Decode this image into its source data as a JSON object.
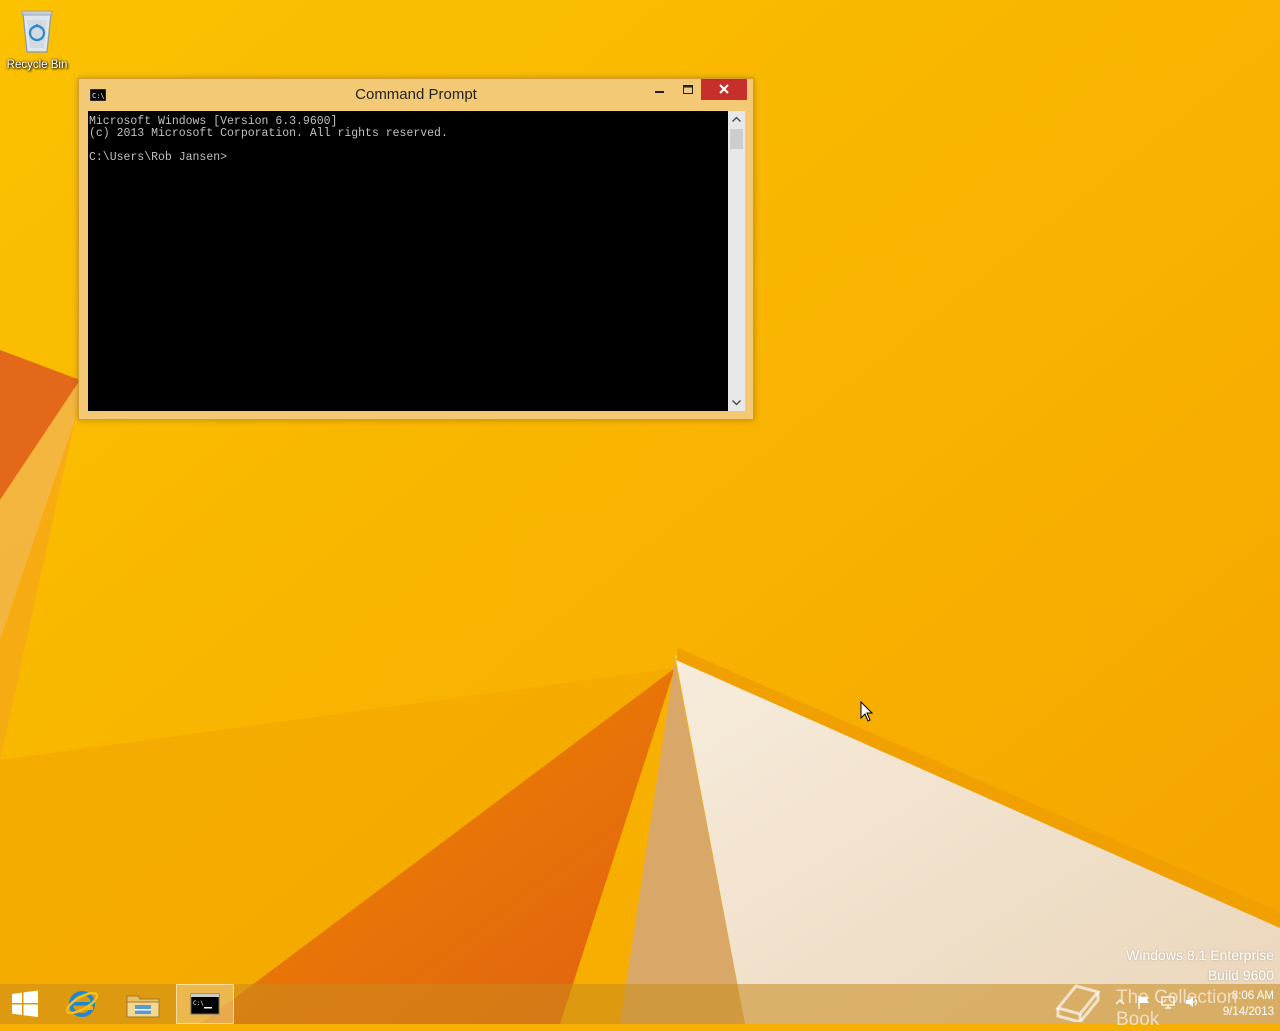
{
  "desktop": {
    "recycle_bin_label": "Recycle Bin"
  },
  "window": {
    "title": "Command Prompt",
    "app_icon": "cmd-icon",
    "buttons": {
      "minimize": "minimize-icon",
      "maximize": "maximize-icon",
      "close": "close-icon"
    },
    "console_lines": [
      "Microsoft Windows [Version 6.3.9600]",
      "(c) 2013 Microsoft Corporation. All rights reserved.",
      "",
      "C:\\Users\\Rob Jansen>"
    ],
    "colors": {
      "frame": "#f3c976",
      "close_button": "#c7302a",
      "console_bg": "#000000",
      "console_text": "#c0c0c0"
    }
  },
  "watermark": {
    "edition": "Windows 8.1 Enterprise",
    "build": "Build 9600"
  },
  "taskbar": {
    "items": [
      "start-button",
      "internet-explorer",
      "file-explorer",
      "command-prompt"
    ],
    "tray": {
      "brand_text": "The Collection Book",
      "time": "8:06 AM",
      "date": "9/14/2013"
    }
  },
  "wallpaper": {
    "base_color": "#f7b000",
    "accent_color": "#e06a0c",
    "paper_color": "#f1e4d2"
  }
}
